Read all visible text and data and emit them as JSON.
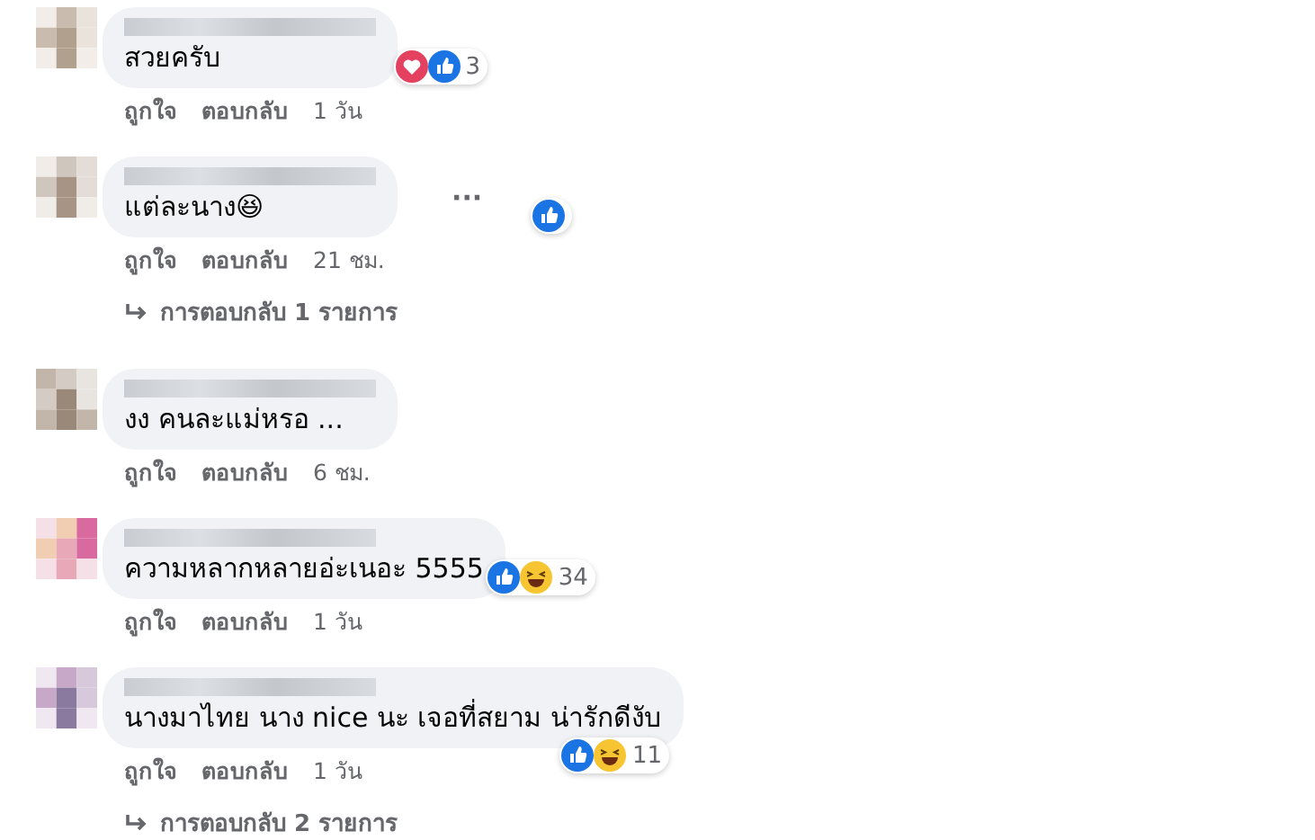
{
  "comments": [
    {
      "text": "สวยครับ",
      "reactions": {
        "items": [
          {
            "kind": "love"
          },
          {
            "kind": "like"
          }
        ],
        "count": "3",
        "below": false
      },
      "actions": {
        "like": "ถูกใจ",
        "reply": "ตอบกลับ",
        "time": "1 วัน"
      }
    },
    {
      "text": "แต่ละนาง😆",
      "reactions": {
        "items": [
          {
            "kind": "like"
          }
        ],
        "below": false
      },
      "more": "···",
      "actions": {
        "like": "ถูกใจ",
        "reply": "ตอบกลับ",
        "time": "21 ชม."
      },
      "replies": "การตอบกลับ 1 รายการ"
    },
    {
      "text": "งง คนละแม่หรอ ...",
      "actions": {
        "like": "ถูกใจ",
        "reply": "ตอบกลับ",
        "time": "6 ชม."
      }
    },
    {
      "text": "ความหลากหลายอ่ะเนอะ 5555",
      "reactions": {
        "items": [
          {
            "kind": "like"
          },
          {
            "kind": "haha"
          }
        ],
        "count": "34",
        "below": false
      },
      "actions": {
        "like": "ถูกใจ",
        "reply": "ตอบกลับ",
        "time": "1 วัน"
      }
    },
    {
      "text": "นางมาไทย นาง nice นะ เจอที่สยาม น่ารักดีงับ",
      "reactions": {
        "items": [
          {
            "kind": "like"
          },
          {
            "kind": "haha"
          }
        ],
        "count": "11",
        "below": true
      },
      "actions": {
        "like": "ถูกใจ",
        "reply": "ตอบกลับ",
        "time": "1 วัน"
      },
      "replies": "การตอบกลับ 2 รายการ"
    }
  ]
}
